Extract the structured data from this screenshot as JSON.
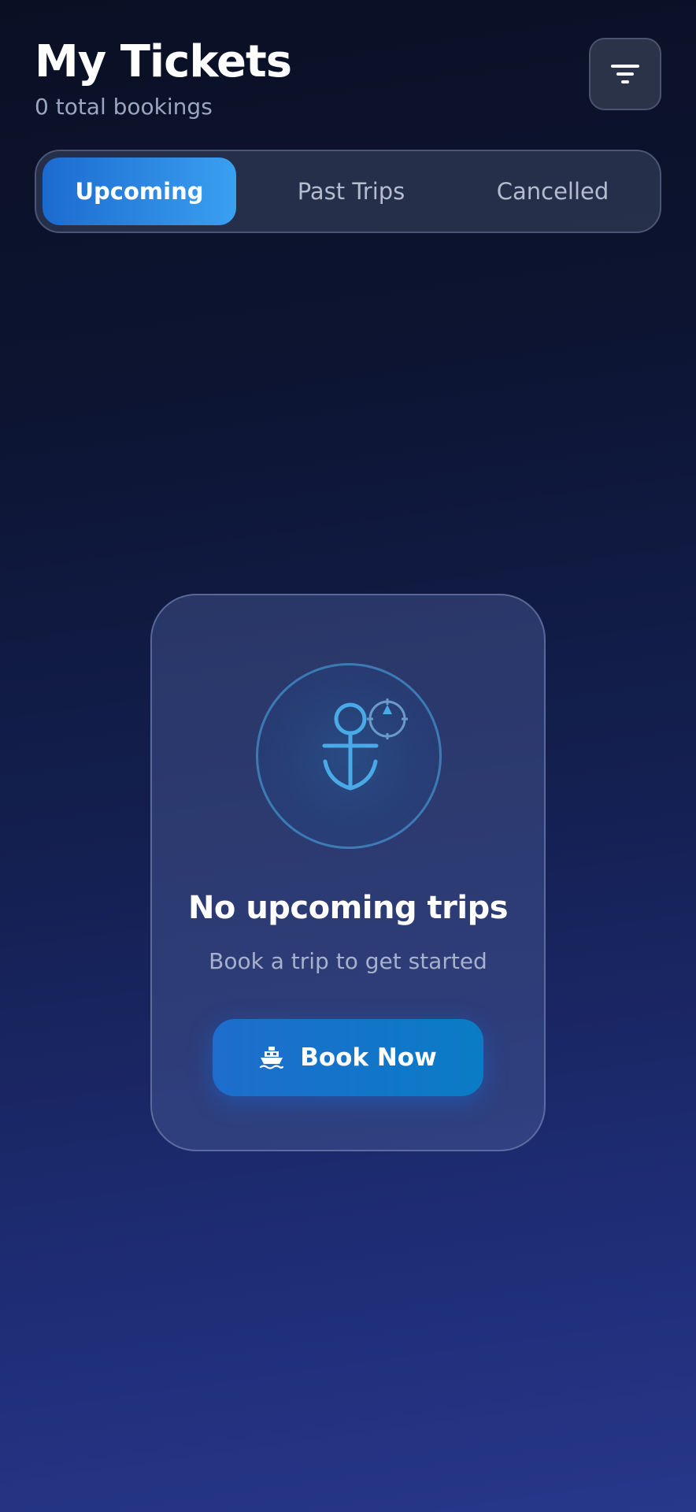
{
  "header": {
    "title": "My Tickets",
    "subtitle": "0 total bookings",
    "filter_icon": "filter-icon"
  },
  "tabs": [
    {
      "label": "Upcoming",
      "active": true
    },
    {
      "label": "Past Trips",
      "active": false
    },
    {
      "label": "Cancelled",
      "active": false
    }
  ],
  "empty_state": {
    "icon": "anchor-compass-icon",
    "title": "No upcoming trips",
    "subtitle": "Book a trip to get started",
    "button_label": "Book Now",
    "button_icon": "ship-icon"
  },
  "colors": {
    "accent": "#1c6bd0",
    "accent_light": "#3aa0f0",
    "icon_blue": "#4aaae8"
  }
}
